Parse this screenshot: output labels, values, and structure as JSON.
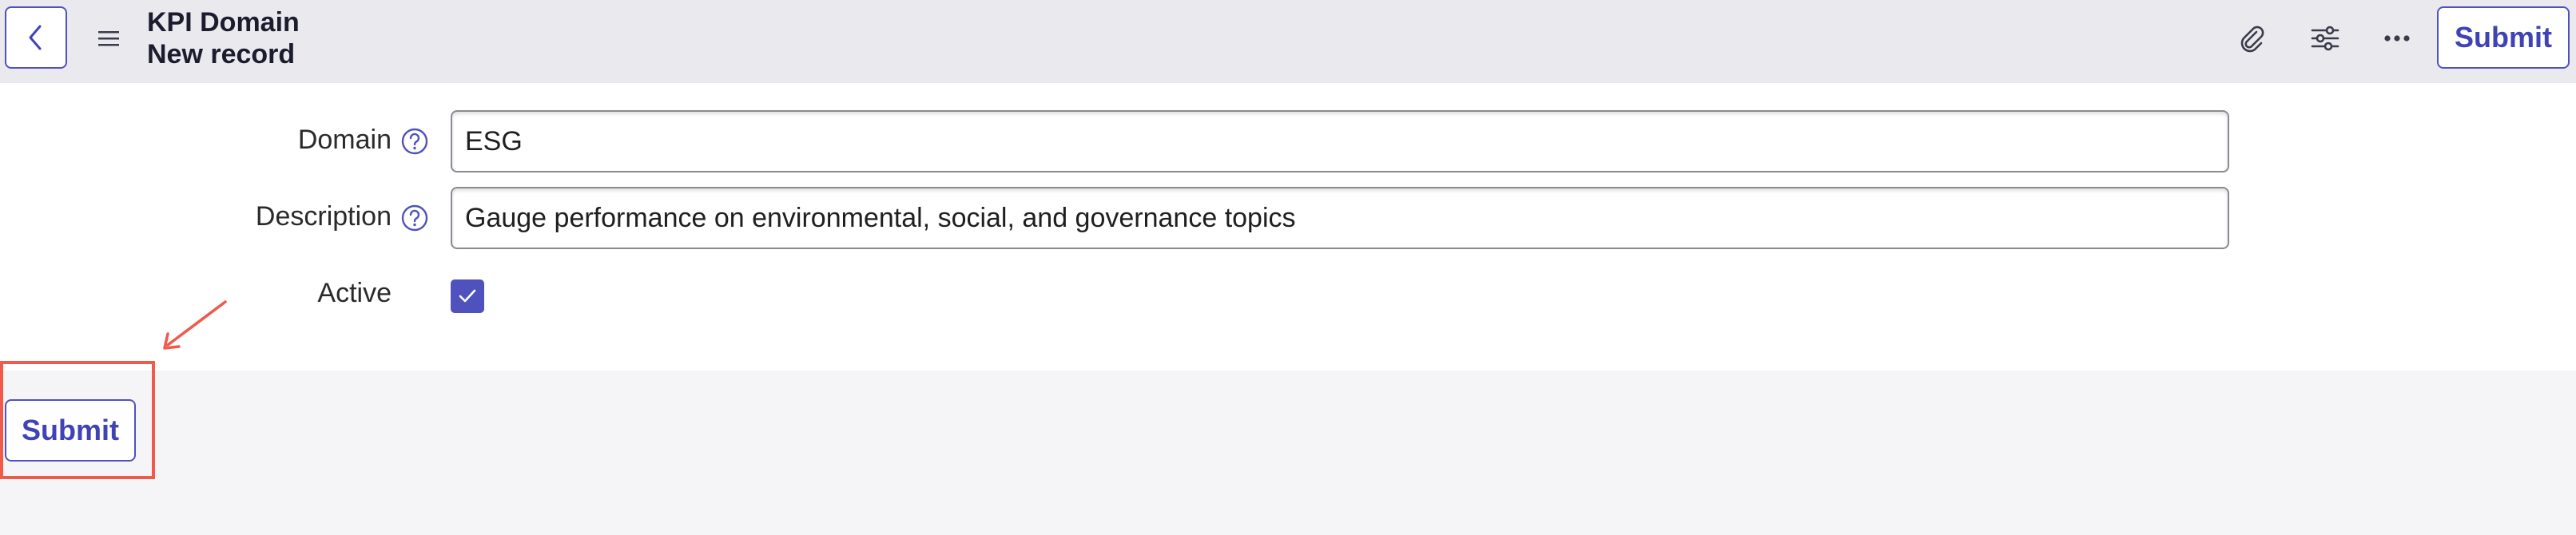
{
  "header": {
    "title": "KPI Domain",
    "subtitle": "New record",
    "submit_label": "Submit",
    "icons": [
      "chevron-left-icon",
      "hamburger-menu-icon",
      "paperclip-icon",
      "sliders-icon",
      "more-horizontal-icon"
    ]
  },
  "form": {
    "fields": [
      {
        "label": "Domain",
        "value": "ESG",
        "help_icon": "question-circle-icon"
      },
      {
        "label": "Description",
        "value": "Gauge performance on environmental, social, and governance topics",
        "help_icon": "question-circle-icon"
      }
    ],
    "active": {
      "label": "Active",
      "checked": true
    }
  },
  "footer": {
    "submit_label": "Submit"
  },
  "colors": {
    "accent": "#4f52bd",
    "header_bg": "#e9e9ee",
    "footer_bg": "#f5f5f8",
    "annotation_red": "#ef5a4b"
  }
}
